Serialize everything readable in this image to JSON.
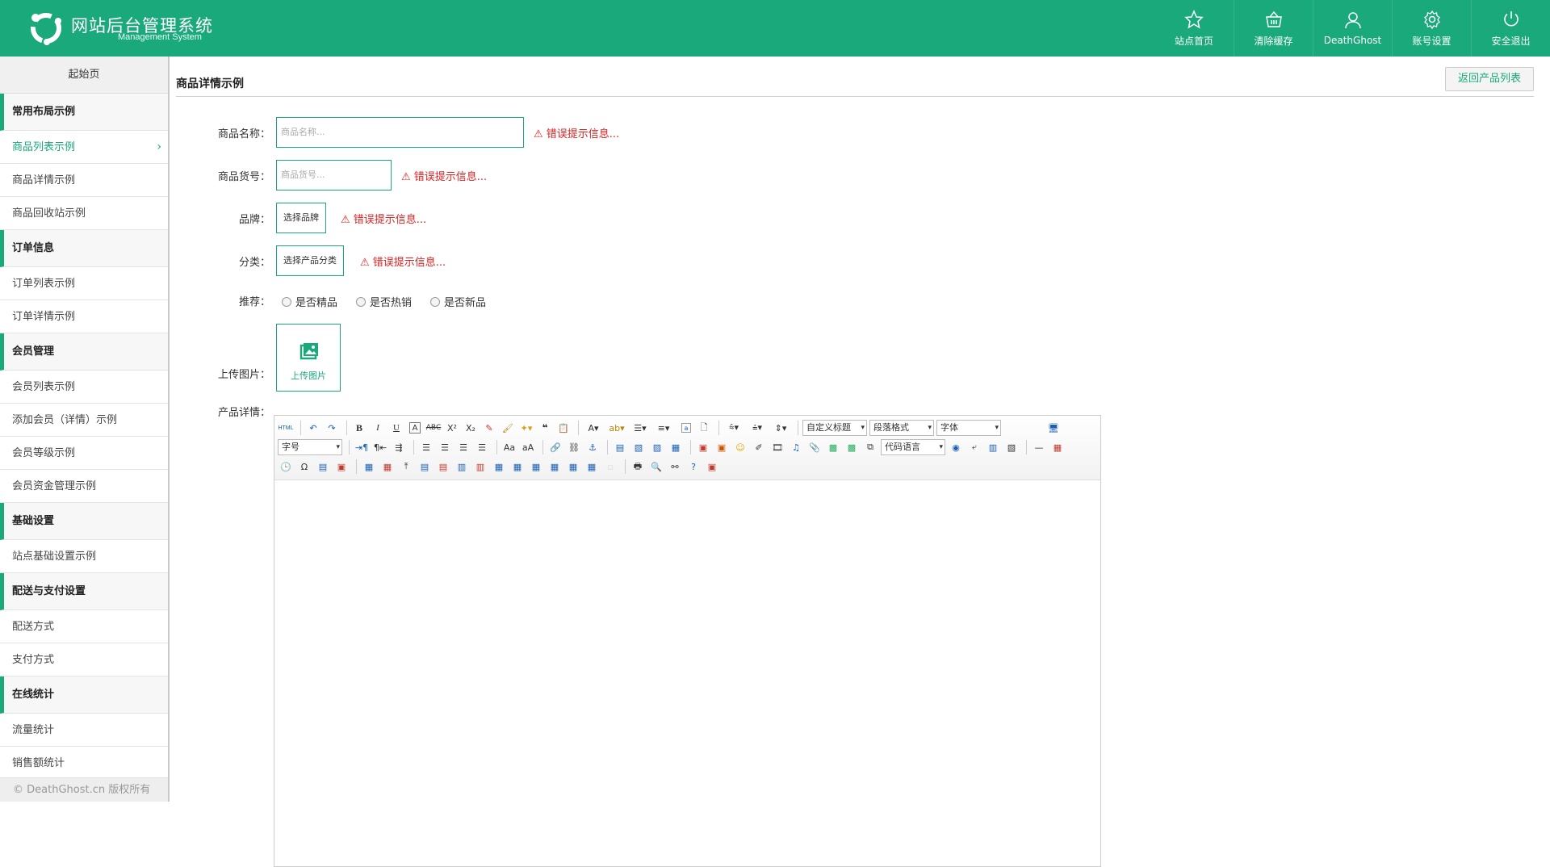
{
  "header": {
    "title": "网站后台管理系统",
    "subtitle": "Management System",
    "nav": [
      {
        "label": "站点首页",
        "icon": "star-icon"
      },
      {
        "label": "清除缓存",
        "icon": "basket-icon"
      },
      {
        "label": "DeathGhost",
        "icon": "user-icon"
      },
      {
        "label": "账号设置",
        "icon": "gear-icon"
      },
      {
        "label": "安全退出",
        "icon": "power-icon"
      }
    ]
  },
  "sidebar": {
    "home": "起始页",
    "groups": [
      {
        "title": "常用布局示例",
        "items": [
          "商品列表示例",
          "商品详情示例",
          "商品回收站示例"
        ]
      },
      {
        "title": "订单信息",
        "items": [
          "订单列表示例",
          "订单详情示例"
        ]
      },
      {
        "title": "会员管理",
        "items": [
          "会员列表示例",
          "添加会员（详情）示例",
          "会员等级示例",
          "会员资金管理示例"
        ]
      },
      {
        "title": "基础设置",
        "items": [
          "站点基础设置示例"
        ]
      },
      {
        "title": "配送与支付设置",
        "items": [
          "配送方式",
          "支付方式"
        ]
      },
      {
        "title": "在线统计",
        "items": [
          "流量统计",
          "销售额统计"
        ]
      }
    ],
    "footer": "© DeathGhost.cn 版权所有"
  },
  "main": {
    "title": "商品详情示例",
    "back_button": "返回产品列表",
    "form": {
      "name_label": "商品名称：",
      "name_placeholder": "商品名称...",
      "sku_label": "商品货号：",
      "sku_placeholder": "商品货号...",
      "brand_label": "品牌：",
      "brand_button": "选择品牌",
      "category_label": "分类：",
      "category_button": "选择产品分类",
      "error": "⚠ 错误提示信息...",
      "recommend_label": "推荐：",
      "recommend_options": [
        "是否精品",
        "是否热销",
        "是否新品"
      ],
      "upload_label": "上传图片：",
      "upload_button": "上传图片",
      "detail_label": "产品详情："
    },
    "editor": {
      "html_label": "HTML",
      "select_heading": "自定义标题",
      "select_paragraph": "段落格式",
      "select_font": "字体",
      "select_size": "字号",
      "select_code": "代码语言"
    }
  },
  "colors": {
    "primary": "#1aa97b",
    "error": "#e02020"
  }
}
